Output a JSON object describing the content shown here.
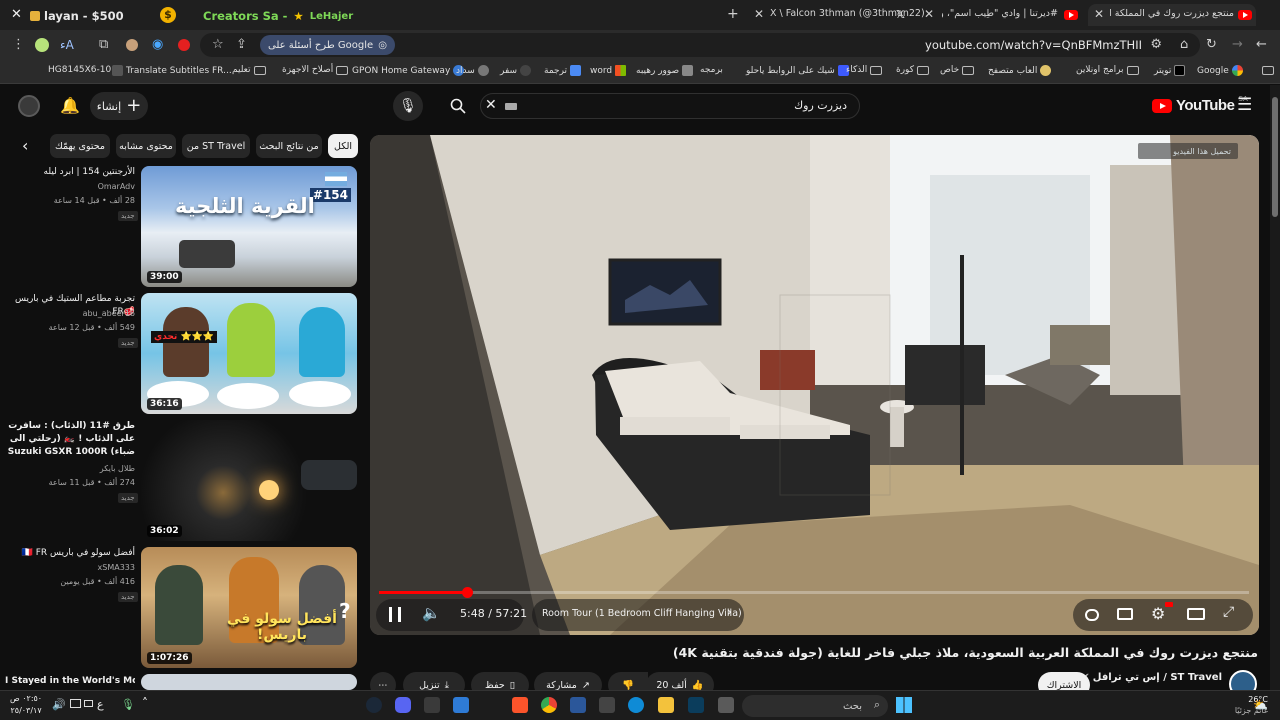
{
  "browser": {
    "tabs": [
      {
        "title": "Creators Sa -",
        "subtitle": "LeHajer"
      },
      {
        "title": "X \\ Falcon 3thman (@3thman22)"
      },
      {
        "title": "#ديرتنا | وادي \"طِيب اسم\"، واحة سياحية"
      },
      {
        "title": "منتجع ديزرت روك في المملكة العربية"
      }
    ],
    "extension_label": "layan - $500",
    "url": "youtube.com/watch?v=QnBFMmzTHII",
    "google_pill": "طرح أسئلة على Google",
    "bookmarks": [
      "Google",
      "تويتر",
      "برامج اونلاين",
      "العاب متصفح",
      "خاص",
      "كورة",
      "الذكاء",
      "شيك على الروابط ياحلو",
      "برمجه",
      "صوور رهيبه",
      "word",
      "ترجمة",
      "سفر",
      "سداد",
      "GPON Home Gateway",
      "أصلاح الاجهزة",
      "تعليم",
      "Translate Subtitles FR...",
      "HG8145X6-10"
    ]
  },
  "yt_header": {
    "logo": "YouTube",
    "region": "SA",
    "search_value": "ديزرت روك",
    "create_label": "إنشاء"
  },
  "chips": [
    "الكل",
    "من نتائج البحث",
    "من ST Travel",
    "محتوى مشابه",
    "محتوى يهمّك"
  ],
  "recommendations": [
    {
      "title": "الأرجنتين 154 | ابرد ليله",
      "channel": "OmarAdv",
      "views": "28 ألف",
      "age": "قبل 14 ساعة",
      "badge": "جديد",
      "duration": "39:00",
      "thumb_text": "القرية الثلجية",
      "thumb_tag": "#154"
    },
    {
      "title": "تجربة مطاعم الستيك في باريس 🥩FR",
      "channel": "abu_abeer16",
      "views": "549 ألف",
      "age": "قبل 12 ساعة",
      "badge": "جديد",
      "duration": "36:16",
      "thumb_text": "تحدي ⭐⭐⭐"
    },
    {
      "title": "طرق #11 (الذئاب) : سافرت على الذئاب ! 🏍️ (رحلتي الى ضباء) Suzuki GSXR 1000R",
      "channel": "طلال بايكر",
      "views": "274 ألف",
      "age": "قبل 11 ساعة",
      "badge": "جديد",
      "duration": "36:02"
    },
    {
      "title": "أفضل سولو في باريس 🇫🇷 FR",
      "channel": "xSMA333",
      "views": "416 ألف",
      "age": "قبل يومين",
      "badge": "جديد",
      "duration": "1:07:26",
      "thumb_text": "أفضل سولو في باريس!"
    },
    {
      "title": "I Stayed in the World's Most"
    }
  ],
  "player": {
    "time_current": "5:48",
    "time_total": "57:21",
    "chapter": "Room Tour (1 Bedroom Cliff Hanging Villa)",
    "progress": 0.101,
    "overlay_text": "تحميل هذا الفيديو"
  },
  "video": {
    "title": "منتجع ديزرت روك في المملكة العربية السعودية، ملاذ جبلي فاخر للغاية (جولة فندقية بتقنية 4K)",
    "channel": "ST Travel / إس تي ترافل",
    "subscribe_label": "الاشتراك",
    "likes": "20 ألف",
    "share_label": "مشاركة",
    "save_label": "حفظ",
    "download_label": "تنزيل"
  },
  "taskbar": {
    "search_placeholder": "بحث",
    "weather_temp": "26°C",
    "weather_desc": "غائم جزئيًا",
    "time": "٠٢:٥٠ ص",
    "date": "٢٥/٠٣/١٧",
    "lang": "ع"
  },
  "colors": {
    "accent": "#ff0000",
    "background": "#0f0f0f",
    "chip_bg": "#272727"
  }
}
